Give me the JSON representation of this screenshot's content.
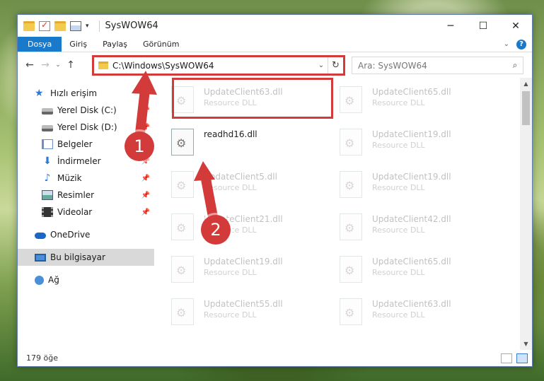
{
  "window": {
    "title": "SysWOW64",
    "controls": {
      "minimize": "─",
      "maximize": "☐",
      "close": "✕"
    }
  },
  "ribbon": {
    "tabs": [
      "Dosya",
      "Giriş",
      "Paylaş",
      "Görünüm"
    ],
    "help": "?"
  },
  "address": {
    "path": "C:\\Windows\\SysWOW64",
    "search_placeholder": "Ara: SysWOW64"
  },
  "nav_pane": {
    "quick_access": "Hızlı erişim",
    "pinned": [
      "Yerel Disk (C:)",
      "Yerel Disk (D:)",
      "Belgeler",
      "İndirmeler",
      "Müzik",
      "Resimler",
      "Videolar"
    ],
    "onedrive": "OneDrive",
    "this_pc": "Bu bilgisayar",
    "network": "Ağ"
  },
  "files": {
    "left": [
      {
        "name": "UpdateClient63.dll",
        "desc": "Resource DLL"
      },
      {
        "name": "readhd16.dll",
        "desc": ""
      },
      {
        "name": "UpdateClient5.dll",
        "desc": "Resource DLL"
      },
      {
        "name": "UpdateClient21.dll",
        "desc": "Resource DLL"
      },
      {
        "name": "UpdateClient19.dll",
        "desc": "Resource DLL"
      },
      {
        "name": "UpdateClient55.dll",
        "desc": "Resource DLL"
      }
    ],
    "right": [
      {
        "name": "UpdateClient65.dll",
        "desc": "Resource DLL"
      },
      {
        "name": "UpdateClient19.dll",
        "desc": "Resource DLL"
      },
      {
        "name": "UpdateClient19.dll",
        "desc": "Resource DLL"
      },
      {
        "name": "UpdateClient42.dll",
        "desc": "Resource DLL"
      },
      {
        "name": "UpdateClient65.dll",
        "desc": "Resource DLL"
      },
      {
        "name": "UpdateClient63.dll",
        "desc": "Resource DLL"
      }
    ]
  },
  "status": {
    "count": "179 öğe"
  },
  "callouts": {
    "first": "1",
    "second": "2"
  },
  "colors": {
    "highlight": "#d33a3a",
    "accent": "#1979ca"
  }
}
